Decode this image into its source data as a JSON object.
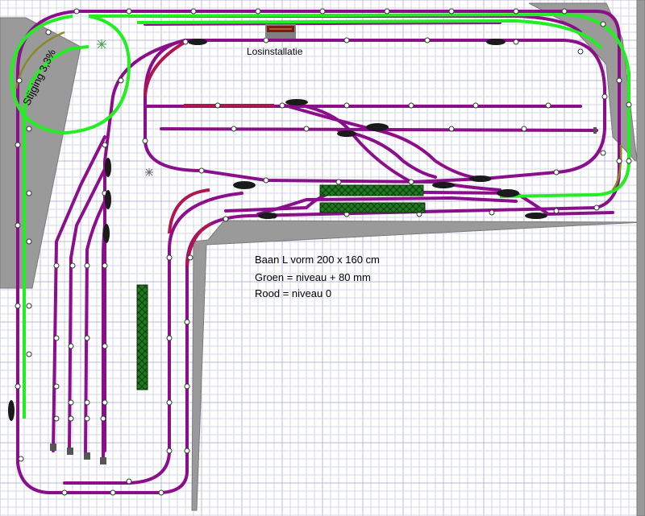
{
  "labels": {
    "slope": "Stijging 3,3%",
    "unloading": "Losinstallatie",
    "layout_title": "Baan L vorm 200 x 160 cm",
    "green_legend": "Groen = niveau + 80 mm",
    "red_legend": "Rood = niveau  0"
  },
  "colors": {
    "track": "#8b0f8b",
    "track_red": "#b0154f",
    "green": "#22ee22",
    "olive": "#8a8a22",
    "wall": "#9a9a9a",
    "grid_minor": "#d6d6ea",
    "grid_major": "#b9b9d6",
    "platform": "#1f7a1f",
    "platform_border": "#0b3b0b"
  }
}
